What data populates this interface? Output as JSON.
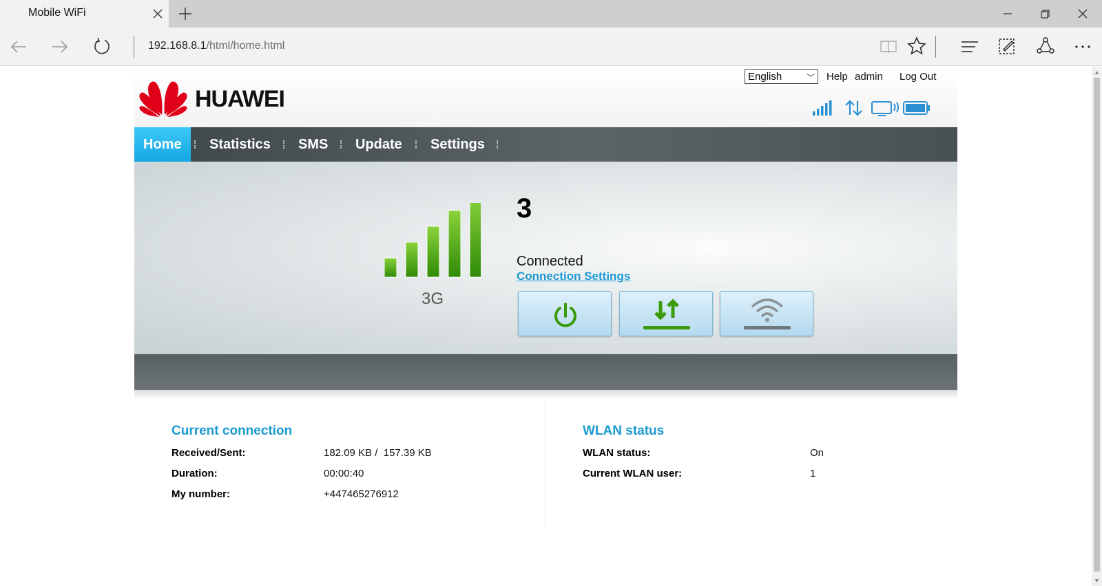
{
  "browser": {
    "tab_title": "Mobile WiFi",
    "address_host": "192.168.8.1",
    "address_path": "/html/home.html"
  },
  "header": {
    "brand": "HUAWEI",
    "language": "English",
    "help": "Help",
    "user": "admin",
    "logout": "Log Out"
  },
  "menu": {
    "items": [
      "Home",
      "Statistics",
      "SMS",
      "Update",
      "Settings"
    ],
    "active": "Home"
  },
  "hero": {
    "signal_strength": 5,
    "network_type": "3G",
    "operator": "3",
    "status": "Connected",
    "settings_link": "Connection Settings"
  },
  "current_connection": {
    "title": "Current connection",
    "received_sent_label": "Received/Sent:",
    "received_sent_value": "182.09 KB /  157.39 KB",
    "duration_label": "Duration:",
    "duration_value": "00:00:40",
    "number_label": "My number:",
    "number_value": "+447465276912"
  },
  "wlan": {
    "title": "WLAN status",
    "status_label": "WLAN status:",
    "status_value": "On",
    "users_label": "Current WLAN user:",
    "users_value": "1"
  },
  "colors": {
    "accent": "#1b9ad1",
    "signal_green": "#3a9a0a",
    "menu_dark": "#4b5456"
  }
}
